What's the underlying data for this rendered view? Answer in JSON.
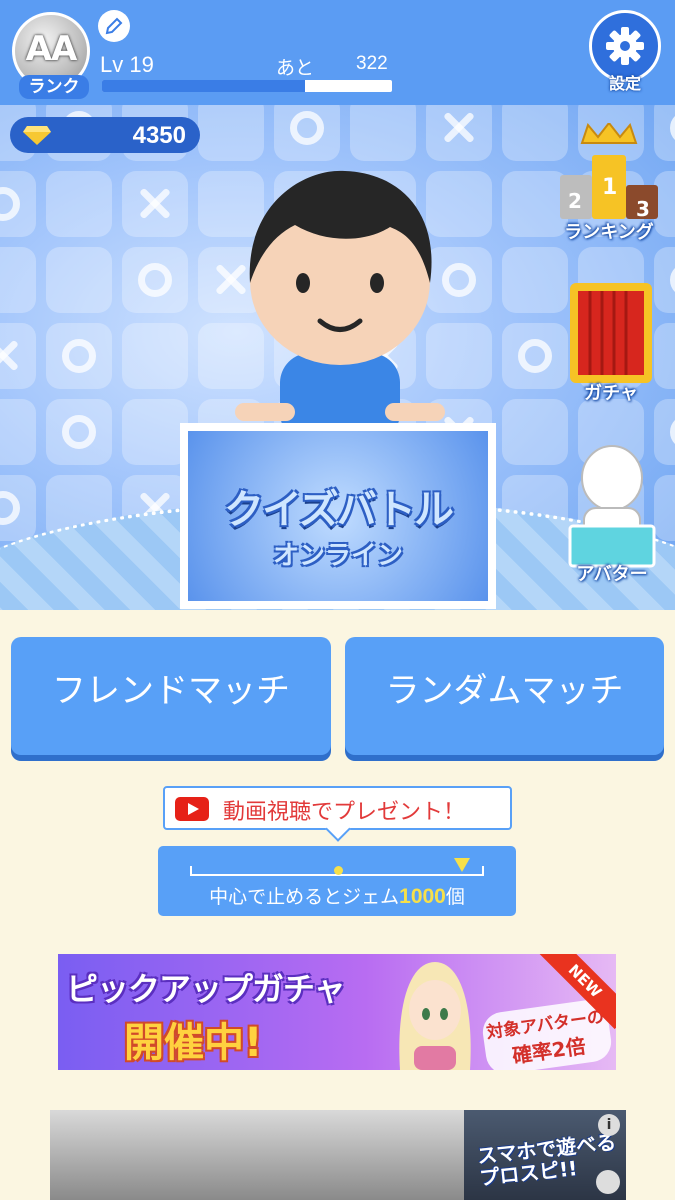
{
  "header": {
    "rank": {
      "grade": "AA",
      "label": "ランク"
    },
    "level_text": "Lv 19",
    "remaining_label": "あと",
    "remaining_value": "322",
    "xp_progress_percent": 70,
    "settings_label": "設定"
  },
  "stage": {
    "gems": "4350",
    "side_buttons": {
      "ranking": "ランキング",
      "ranking_podium": [
        "2",
        "1",
        "3"
      ],
      "gacha": "ガチャ",
      "avatar": "アバター"
    },
    "logo": {
      "title": "クイズバトル",
      "subtitle": "オンライン"
    }
  },
  "matches": {
    "friend": "フレンドマッチ",
    "random": "ランダムマッチ"
  },
  "video_present": {
    "bubble_text": "動画視聴でプレゼント！",
    "stop_text_before": "中心で止めるとジェム",
    "stop_number": "1000",
    "stop_text_after": "個"
  },
  "banner": {
    "title": "ピックアップガチャ",
    "main": "開催中!",
    "sub_line1": "対象アバターの",
    "sub_line2": "確率2倍",
    "ribbon": "NEW"
  },
  "ad": {
    "text_line1": "スマホで遊べる",
    "text_line2": "プロスピ!!",
    "info": "i"
  },
  "colors": {
    "header_bg": "#5b9cf3",
    "button_blue": "#58a0f7",
    "page_bg": "#fbf6e1",
    "gem_pill": "#2a62c9"
  }
}
